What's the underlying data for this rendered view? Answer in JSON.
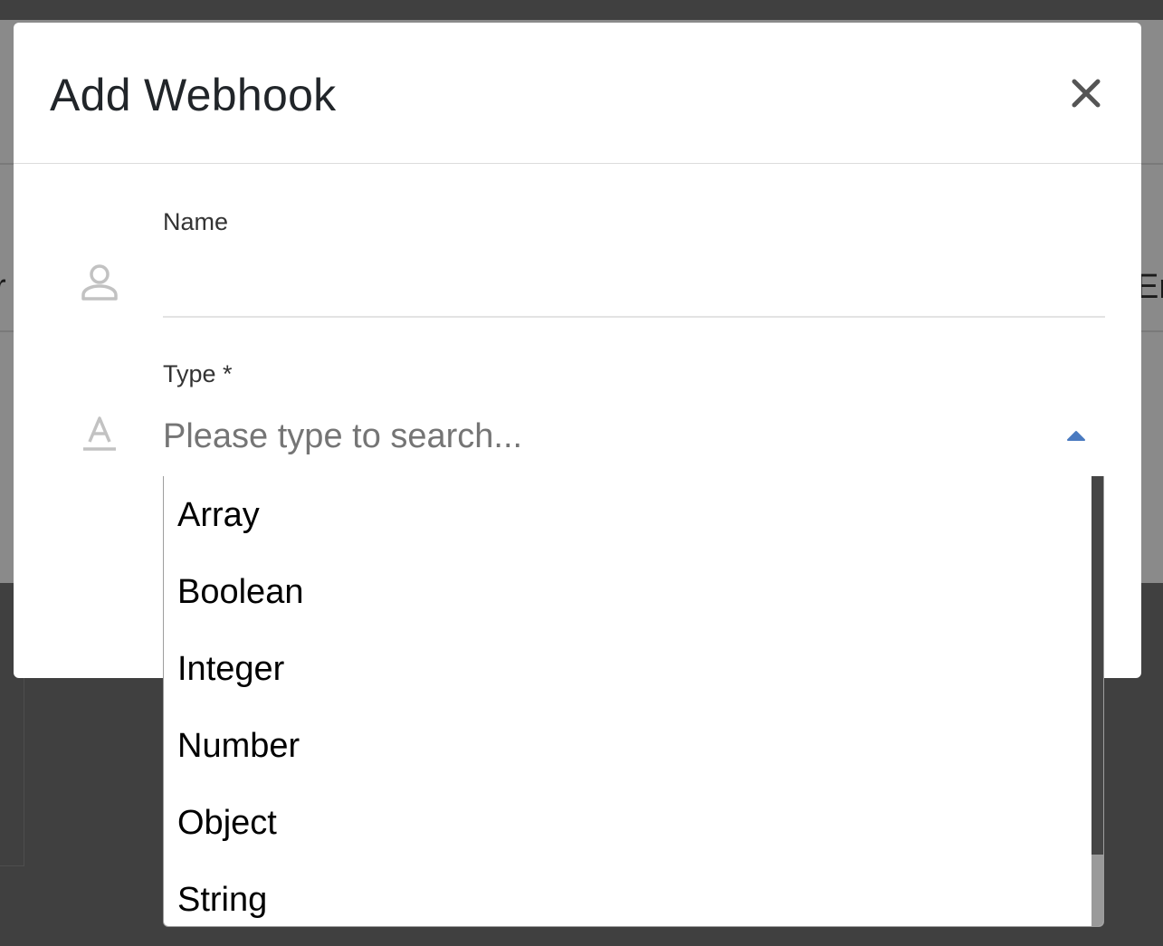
{
  "background": {
    "partial_text_left": "r",
    "partial_text_right": "Er"
  },
  "modal": {
    "title": "Add Webhook",
    "close_icon": "close-icon"
  },
  "form": {
    "name": {
      "label": "Name",
      "value": "",
      "icon": "person-icon"
    },
    "type": {
      "label": "Type *",
      "placeholder": "Please type to search...",
      "value": "",
      "icon": "text-format-icon",
      "toggle_icon": "caret-up-icon",
      "options": [
        "Array",
        "Boolean",
        "Integer",
        "Number",
        "Object",
        "String"
      ]
    }
  },
  "colors": {
    "accent": "#4a7ac0",
    "overlay": "#404040",
    "modal_bg": "#ffffff"
  }
}
